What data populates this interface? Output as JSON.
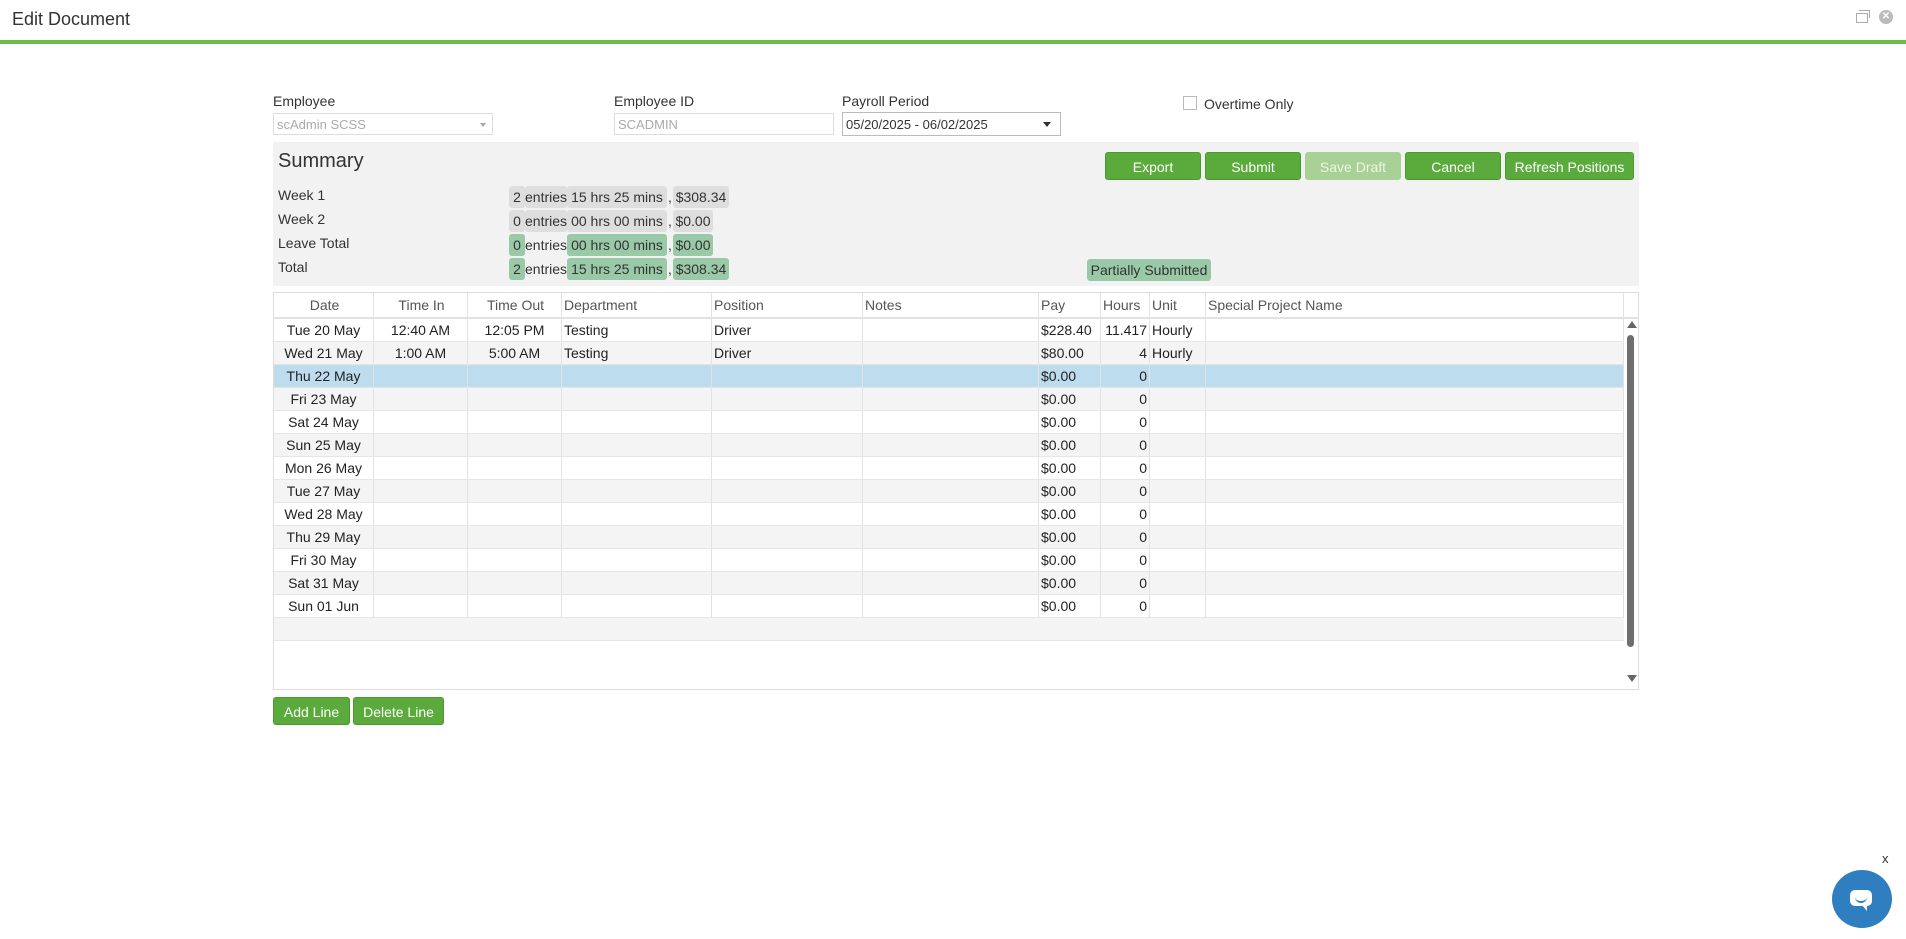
{
  "window": {
    "title": "Edit Document"
  },
  "form": {
    "employee_label": "Employee",
    "employee_value": "scAdmin SCSS",
    "employee_id_label": "Employee ID",
    "employee_id_value": "SCADMIN",
    "payroll_period_label": "Payroll Period",
    "payroll_period_value": "05/20/2025 - 06/02/2025",
    "overtime_only_label": "Overtime Only",
    "overtime_only_checked": false
  },
  "summary": {
    "title": "Summary",
    "buttons": {
      "export": "Export",
      "submit": "Submit",
      "save_draft": "Save Draft",
      "cancel": "Cancel",
      "refresh_positions": "Refresh Positions"
    },
    "rows": [
      {
        "label": "Week 1",
        "entries_count": "2",
        "entries_word": "entries",
        "hours": "15 hrs 25 mins",
        "sep": ",",
        "amount": "$308.34"
      },
      {
        "label": "Week 2",
        "entries_count": "0",
        "entries_word": "entries",
        "hours": "00 hrs 00 mins",
        "sep": ",",
        "amount": "$0.00"
      },
      {
        "label": "Leave Total",
        "entries_count": "0",
        "entries_word": "entries",
        "hours": "00 hrs 00 mins",
        "sep": ",",
        "amount": "$0.00"
      },
      {
        "label": "Total",
        "entries_count": "2",
        "entries_word": "entries",
        "hours": "15 hrs 25 mins",
        "sep": ",",
        "amount": "$308.34"
      }
    ],
    "status_badge": "Partially Submitted"
  },
  "grid": {
    "columns": [
      "Date",
      "Time In",
      "Time Out",
      "Department",
      "Position",
      "Notes",
      "Pay",
      "Hours",
      "Unit",
      "Special Project Name"
    ],
    "rows": [
      {
        "date": "Tue 20 May",
        "time_in": "12:40 AM",
        "time_out": "12:05 PM",
        "department": "Testing",
        "position": "Driver",
        "notes": "",
        "pay": "$228.40",
        "hours": "11.417",
        "unit": "Hourly",
        "special": ""
      },
      {
        "date": "Wed 21 May",
        "time_in": "1:00 AM",
        "time_out": "5:00 AM",
        "department": "Testing",
        "position": "Driver",
        "notes": "",
        "pay": "$80.00",
        "hours": "4",
        "unit": "Hourly",
        "special": ""
      },
      {
        "date": "Thu 22 May",
        "time_in": "",
        "time_out": "",
        "department": "",
        "position": "",
        "notes": "",
        "pay": "$0.00",
        "hours": "0",
        "unit": "",
        "special": ""
      },
      {
        "date": "Fri 23 May",
        "time_in": "",
        "time_out": "",
        "department": "",
        "position": "",
        "notes": "",
        "pay": "$0.00",
        "hours": "0",
        "unit": "",
        "special": ""
      },
      {
        "date": "Sat 24 May",
        "time_in": "",
        "time_out": "",
        "department": "",
        "position": "",
        "notes": "",
        "pay": "$0.00",
        "hours": "0",
        "unit": "",
        "special": ""
      },
      {
        "date": "Sun 25 May",
        "time_in": "",
        "time_out": "",
        "department": "",
        "position": "",
        "notes": "",
        "pay": "$0.00",
        "hours": "0",
        "unit": "",
        "special": ""
      },
      {
        "date": "Mon 26 May",
        "time_in": "",
        "time_out": "",
        "department": "",
        "position": "",
        "notes": "",
        "pay": "$0.00",
        "hours": "0",
        "unit": "",
        "special": ""
      },
      {
        "date": "Tue 27 May",
        "time_in": "",
        "time_out": "",
        "department": "",
        "position": "",
        "notes": "",
        "pay": "$0.00",
        "hours": "0",
        "unit": "",
        "special": ""
      },
      {
        "date": "Wed 28 May",
        "time_in": "",
        "time_out": "",
        "department": "",
        "position": "",
        "notes": "",
        "pay": "$0.00",
        "hours": "0",
        "unit": "",
        "special": ""
      },
      {
        "date": "Thu 29 May",
        "time_in": "",
        "time_out": "",
        "department": "",
        "position": "",
        "notes": "",
        "pay": "$0.00",
        "hours": "0",
        "unit": "",
        "special": ""
      },
      {
        "date": "Fri 30 May",
        "time_in": "",
        "time_out": "",
        "department": "",
        "position": "",
        "notes": "",
        "pay": "$0.00",
        "hours": "0",
        "unit": "",
        "special": ""
      },
      {
        "date": "Sat 31 May",
        "time_in": "",
        "time_out": "",
        "department": "",
        "position": "",
        "notes": "",
        "pay": "$0.00",
        "hours": "0",
        "unit": "",
        "special": ""
      },
      {
        "date": "Sun 01 Jun",
        "time_in": "",
        "time_out": "",
        "department": "",
        "position": "",
        "notes": "",
        "pay": "$0.00",
        "hours": "0",
        "unit": "",
        "special": ""
      }
    ],
    "selected_row_index": 2
  },
  "actions": {
    "add_line": "Add Line",
    "delete_line": "Delete Line"
  },
  "chat": {
    "close_label": "x"
  },
  "colors": {
    "accent": "#6cbd45",
    "button": "#5aab3b",
    "selected_row": "#bddcee",
    "summary_chip_green": "#9ac9a7"
  }
}
